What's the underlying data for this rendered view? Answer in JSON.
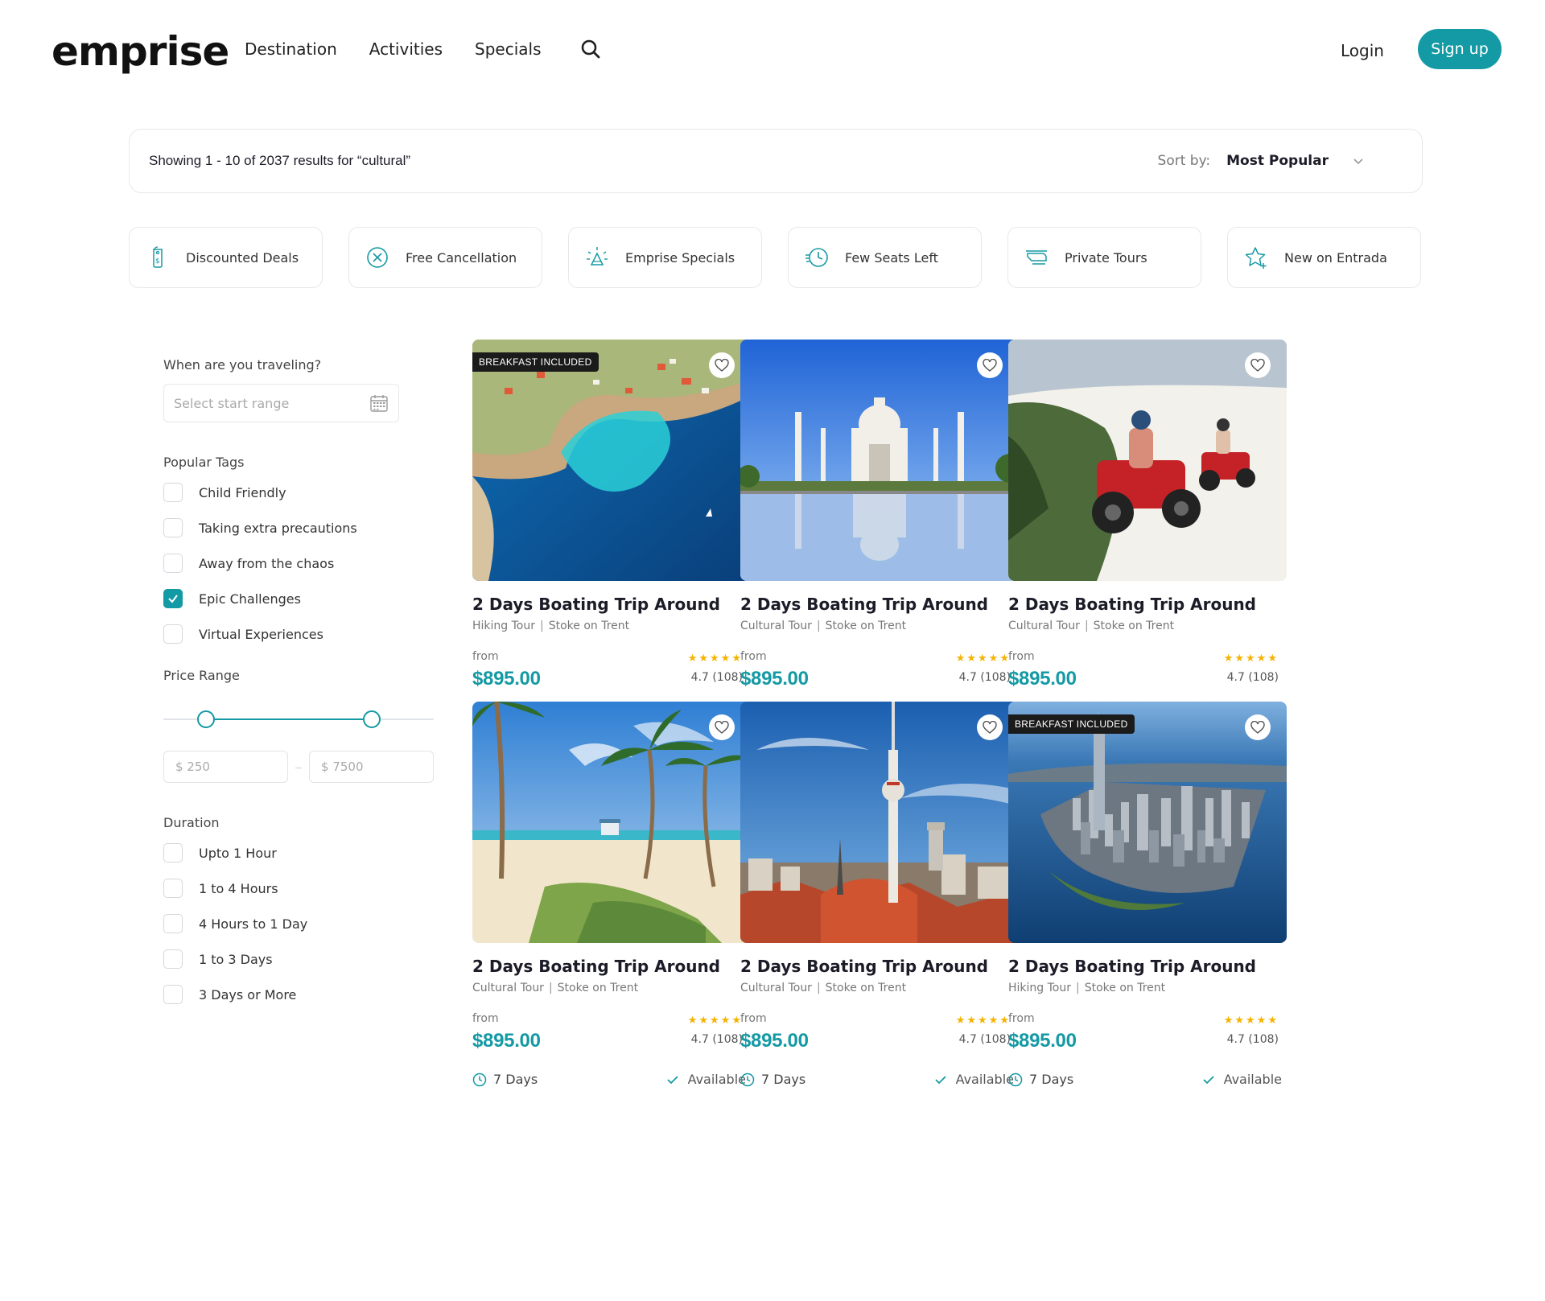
{
  "header": {
    "logo": "emprise",
    "nav": [
      "Destination",
      "Activities",
      "Specials"
    ],
    "login": "Login",
    "signup": "Sign up"
  },
  "results": {
    "summary": "Showing 1 - 10 of 2037 results for “cultural”",
    "sort_label": "Sort by:",
    "sort_value": "Most Popular"
  },
  "chips": [
    {
      "label": "Discounted Deals",
      "icon": "price-tag-icon"
    },
    {
      "label": "Free Cancellation",
      "icon": "cancel-circle-icon"
    },
    {
      "label": "Emprise Specials",
      "icon": "sparkle-bell-icon"
    },
    {
      "label": "Few Seats Left",
      "icon": "fast-clock-icon"
    },
    {
      "label": "Private Tours",
      "icon": "helicopter-icon"
    },
    {
      "label": "New on Entrada",
      "icon": "star-plus-icon"
    }
  ],
  "sidebar": {
    "date_label": "When are you traveling?",
    "date_placeholder": "Select start range",
    "tags_label": "Popular Tags",
    "tags": [
      {
        "label": "Child Friendly",
        "checked": false
      },
      {
        "label": "Taking extra precautions",
        "checked": false
      },
      {
        "label": "Away from the chaos",
        "checked": false
      },
      {
        "label": "Epic Challenges",
        "checked": true
      },
      {
        "label": "Virtual Experiences",
        "checked": false
      }
    ],
    "price_label": "Price Range",
    "price_min": "$ 250",
    "price_max": "$ 7500",
    "duration_label": "Duration",
    "durations": [
      {
        "label": "Upto 1 Hour",
        "checked": false
      },
      {
        "label": "1 to 4 Hours",
        "checked": false
      },
      {
        "label": "4 Hours to 1 Day",
        "checked": false
      },
      {
        "label": "1 to 3 Days",
        "checked": false
      },
      {
        "label": "3 Days or More",
        "checked": false
      }
    ]
  },
  "cards": [
    {
      "badge": "BREAKFAST INCLUDED",
      "title": "2 Days Boating Trip Around",
      "type": "Hiking Tour",
      "location": "Stoke on Trent",
      "from": "from",
      "price": "$895.00",
      "stars": "★★★★★",
      "rating": "4.7 (108)",
      "duration": "7 Days",
      "availability": "Available",
      "image": "coastal-bay"
    },
    {
      "badge": "",
      "title": "2 Days Boating Trip Around",
      "type": "Cultural Tour",
      "location": "Stoke on Trent",
      "from": "from",
      "price": "$895.00",
      "stars": "★★★★★",
      "rating": "4.7 (108)",
      "duration": "7 Days",
      "availability": "Available",
      "image": "taj-mahal"
    },
    {
      "badge": "",
      "title": "2 Days Boating Trip Around",
      "type": "Cultural Tour",
      "location": "Stoke on Trent",
      "from": "from",
      "price": "$895.00",
      "stars": "★★★★★",
      "rating": "4.7 (108)",
      "duration": "7 Days",
      "availability": "Available",
      "image": "quad-bikes"
    },
    {
      "badge": "",
      "title": "2 Days Boating Trip Around",
      "type": "Cultural Tour",
      "location": "Stoke on Trent",
      "from": "from",
      "price": "$895.00",
      "stars": "★★★★★",
      "rating": "4.7 (108)",
      "duration": "7 Days",
      "availability": "Available",
      "image": "palm-beach"
    },
    {
      "badge": "",
      "title": "2 Days Boating Trip Around",
      "type": "Cultural Tour",
      "location": "Stoke on Trent",
      "from": "from",
      "price": "$895.00",
      "stars": "★★★★★",
      "rating": "4.7 (108)",
      "duration": "7 Days",
      "availability": "Available",
      "image": "tv-tower-city"
    },
    {
      "badge": "BREAKFAST INCLUDED",
      "title": "2 Days Boating Trip Around",
      "type": "Hiking Tour",
      "location": "Stoke on Trent",
      "from": "from",
      "price": "$895.00",
      "stars": "★★★★★",
      "rating": "4.7 (108)",
      "duration": "7 Days",
      "availability": "Available",
      "image": "manhattan-aerial"
    }
  ],
  "colors": {
    "accent": "#149aa4",
    "star": "#f5b301",
    "badge_bg": "#1b1b1b"
  }
}
